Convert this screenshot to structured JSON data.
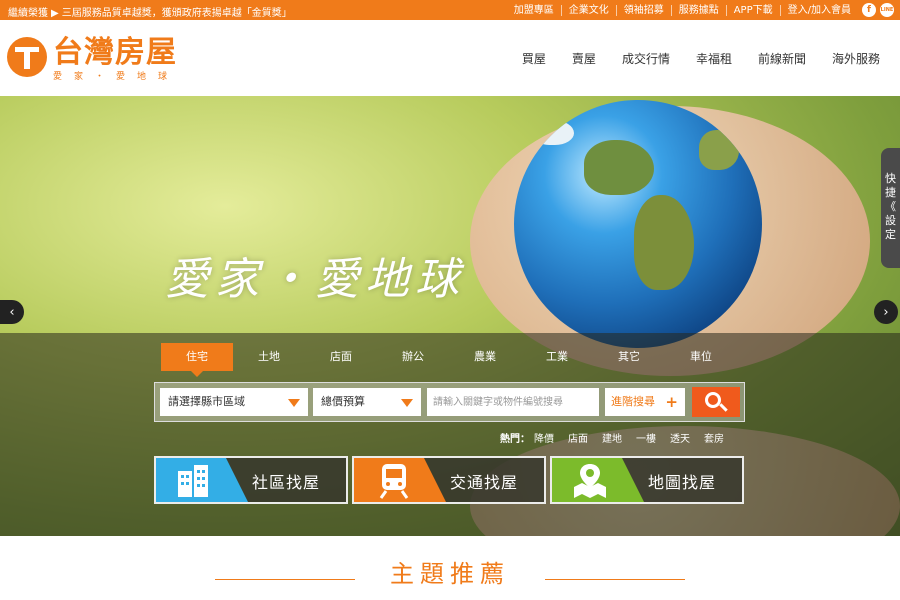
{
  "topbar": {
    "ticker_label": "繼續榮獲",
    "ticker_text": "三屆服務品質卓越獎，獲頒政府表揚卓越「金質獎」",
    "links": [
      "加盟專區",
      "企業文化",
      "領袖招募",
      "服務據點",
      "APP下載",
      "登入/加入會員"
    ],
    "facebook_glyph": "f",
    "line_glyph": "LINE"
  },
  "logo": {
    "title": "台灣房屋",
    "subtitle": "愛家・愛地球"
  },
  "nav": [
    "買屋",
    "賣屋",
    "成交行情",
    "幸福租",
    "前線新聞",
    "海外服務"
  ],
  "hero": {
    "slogan": "愛家・愛地球",
    "quick_settings": [
      "快",
      "捷",
      "《",
      "設",
      "定"
    ],
    "prev_glyph": "‹",
    "next_glyph": "›"
  },
  "search": {
    "tabs": [
      "住宅",
      "土地",
      "店面",
      "辦公",
      "農業",
      "工業",
      "其它",
      "車位"
    ],
    "active_tab": "住宅",
    "region_select": "請選擇縣市區域",
    "budget_select": "總價預算",
    "keyword_placeholder": "請輸入關鍵字或物件編號搜尋",
    "advanced_label": "進階搜尋",
    "advanced_plus": "+",
    "hot_label": "熱門：",
    "hot_keywords": [
      "降價",
      "店面",
      "建地",
      "一樓",
      "透天",
      "套房"
    ]
  },
  "finders": [
    {
      "label": "社區找屋",
      "icon": "building-icon",
      "color": "#33aee6"
    },
    {
      "label": "交通找屋",
      "icon": "train-icon",
      "color": "#f07b1a"
    },
    {
      "label": "地圖找屋",
      "icon": "map-pin-icon",
      "color": "#7cbb2b"
    }
  ],
  "section": {
    "title": "主題推薦"
  },
  "colors": {
    "brand": "#f07b1a",
    "search_button": "#f05a1c"
  }
}
